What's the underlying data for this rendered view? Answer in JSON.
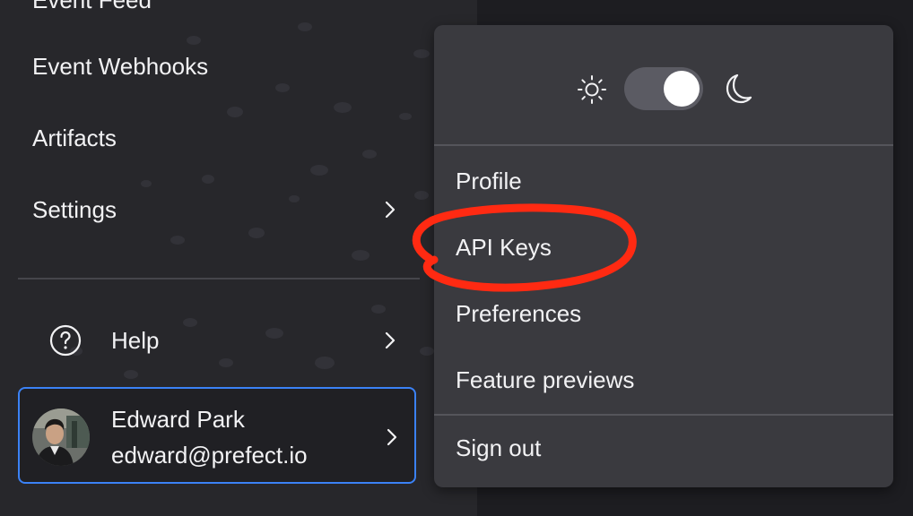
{
  "sidebar": {
    "items": [
      {
        "label": "Event Feed"
      },
      {
        "label": "Event Webhooks"
      },
      {
        "label": "Artifacts"
      },
      {
        "label": "Settings",
        "icon": "chevron-right-icon"
      }
    ],
    "help": {
      "label": "Help",
      "icon": "question-circle-icon"
    },
    "user": {
      "name": "Edward Park",
      "email": "edward@prefect.io",
      "avatar": "user-avatar-photo",
      "border_color": "#3b82f6"
    }
  },
  "dropdown": {
    "theme": {
      "light_icon": "sun-icon",
      "dark_icon": "moon-icon",
      "selected": "dark"
    },
    "items": [
      {
        "label": "Profile"
      },
      {
        "label": "API Keys",
        "highlighted": true
      },
      {
        "label": "Preferences"
      },
      {
        "label": "Feature previews"
      },
      {
        "label": "Sign out"
      }
    ]
  },
  "annotation": {
    "color": "#ff2a12",
    "shape": "hand-drawn-ellipse"
  }
}
